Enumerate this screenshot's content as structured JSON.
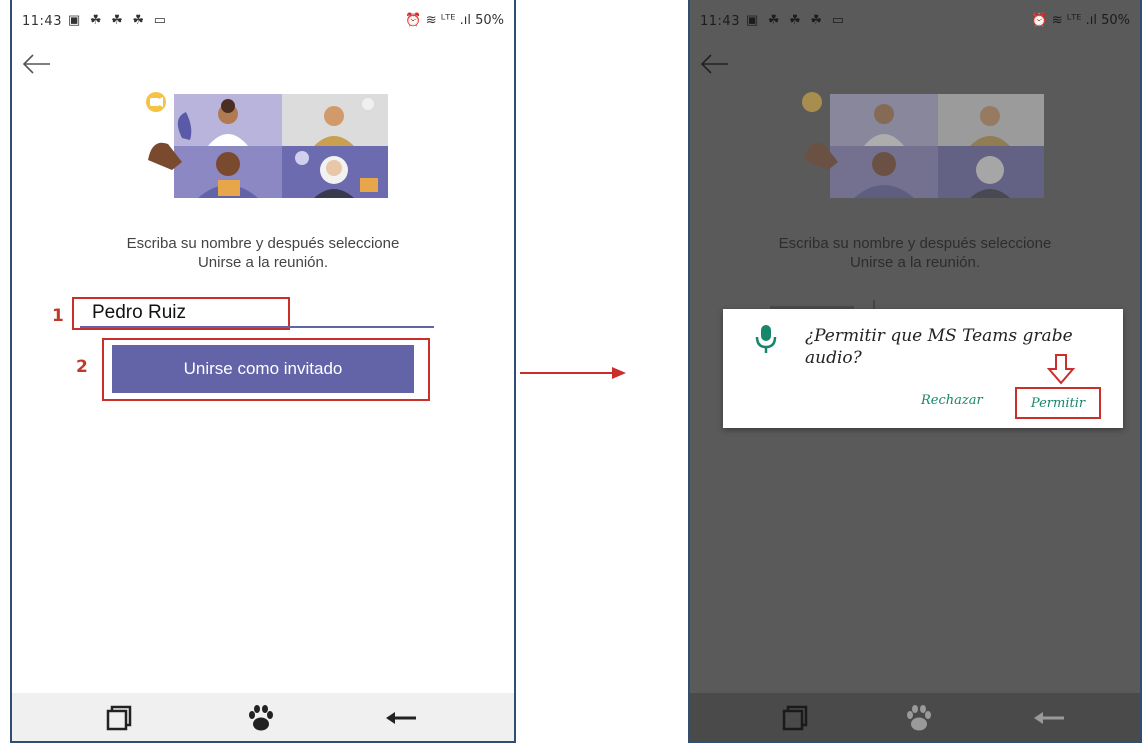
{
  "status_bar": {
    "time": "11:43",
    "notification_icons": "▣ ☘ ☘ ☘ ▭",
    "right_indicators": "⏰ ≋ ᴸᵀᴱ .ıl 50%"
  },
  "left_screen": {
    "instructions_line1": "Escriba su nombre y después seleccione",
    "instructions_line2": "Unirse a la reunión.",
    "name_field_value": "Pedro Ruiz",
    "join_button_label": "Unirse como invitado",
    "annotation_step1": "1",
    "annotation_step2": "2"
  },
  "right_screen": {
    "instructions_line1": "Escriba su nombre y después seleccione",
    "instructions_line2": "Unirse a la reunión.",
    "permission_dialog": {
      "question": "¿Permitir que MS Teams grabe audio?",
      "deny_label": "Rechazar",
      "allow_label": "Permitir"
    }
  },
  "colors": {
    "teams_purple": "#6264a7",
    "annotation_red": "#c9302c",
    "dialog_button_green": "#17866a",
    "frame_border": "#2e4f73"
  },
  "icons": {
    "back": "back-arrow-icon",
    "recent_apps": "recent-apps-icon",
    "home": "paw-home-icon",
    "nav_back": "nav-back-icon",
    "microphone": "microphone-icon"
  }
}
